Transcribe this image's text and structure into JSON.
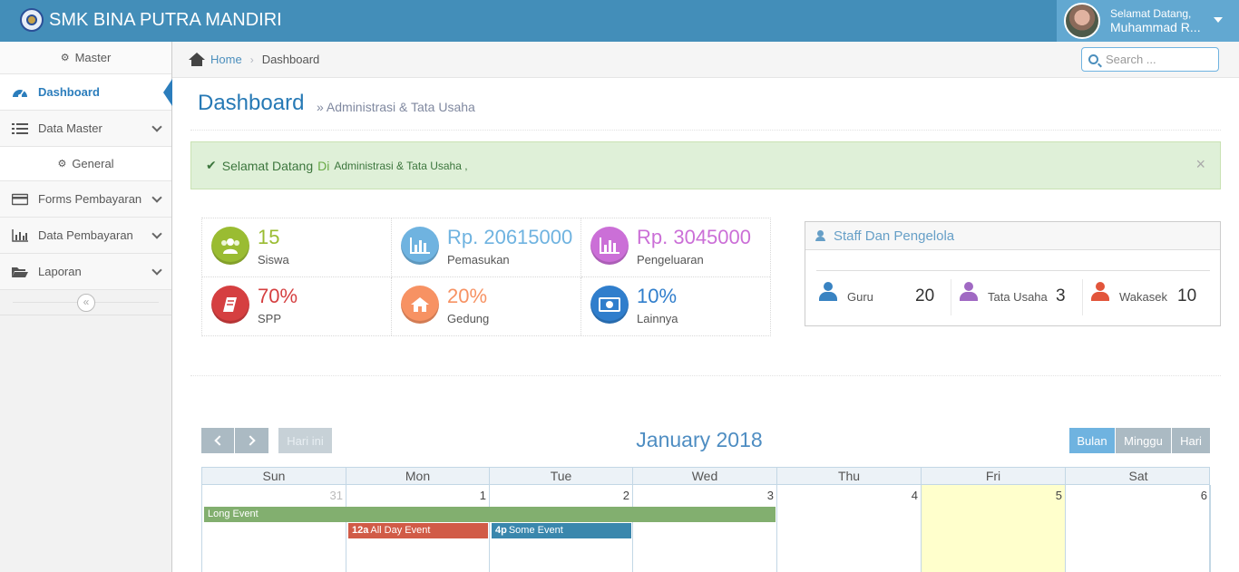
{
  "navbar": {
    "brand": "SMK BINA PUTRA MANDIRI",
    "greeting": "Selamat Datang,",
    "user_name": "Muhammad R..."
  },
  "sidebar": {
    "shortcut": "Master",
    "items": [
      {
        "label": "Dashboard",
        "icon": "tachometer-icon",
        "active": true
      },
      {
        "label": "Data Master",
        "icon": "list-icon"
      },
      {
        "label": "General",
        "icon": "gears-icon",
        "sub": true
      },
      {
        "label": "Forms Pembayaran",
        "icon": "credit-card-icon"
      },
      {
        "label": "Data Pembayaran",
        "icon": "bar-chart-icon"
      },
      {
        "label": "Laporan",
        "icon": "folder-open-icon"
      }
    ],
    "collapse_symbol": "«"
  },
  "breadcrumbs": {
    "home": "Home",
    "separator": "›",
    "current": "Dashboard"
  },
  "search": {
    "placeholder": "Search ..."
  },
  "page_header": {
    "title": "Dashboard",
    "subtitle": "» Administrasi & Tata Usaha"
  },
  "alert": {
    "text1": "Selamat Datang",
    "text2": "Di",
    "text3": "Administrasi & Tata Usaha ,",
    "close": "×"
  },
  "infoboxes": [
    {
      "value": "15",
      "label": "Siswa",
      "color": "#9abc32",
      "icon": "users-icon"
    },
    {
      "value": "Rp. 20615000",
      "label": "Pemasukan",
      "color": "#6fb3e0",
      "icon": "bar-chart-icon"
    },
    {
      "value": "Rp. 3045000",
      "label": "Pengeluaran",
      "color": "#cb6fd7",
      "icon": "bar-chart-icon"
    },
    {
      "value": "70%",
      "label": "SPP",
      "color": "#d53f40",
      "icon": "book-icon"
    },
    {
      "value": "20%",
      "label": "Gedung",
      "color": "#f79263",
      "icon": "home-icon"
    },
    {
      "value": "10%",
      "label": "Lainnya",
      "color": "#307ecc",
      "icon": "money-icon"
    }
  ],
  "staff_widget": {
    "title": "Staff Dan Pengelola",
    "items": [
      {
        "label": "Guru",
        "count": "20",
        "color": "#3983c2"
      },
      {
        "label": "Tata Usaha",
        "count": "3",
        "color": "#a069c3"
      },
      {
        "label": "Wakasek",
        "count": "10",
        "color": "#e2553b"
      }
    ]
  },
  "calendar": {
    "prev_symbol": "‹",
    "next_symbol": "›",
    "today_label": "Hari ini",
    "title": "January 2018",
    "views": [
      "Bulan",
      "Minggu",
      "Hari"
    ],
    "active_view": "Bulan",
    "weekdays": [
      "Sun",
      "Mon",
      "Tue",
      "Wed",
      "Thu",
      "Fri",
      "Sat"
    ],
    "days": [
      "31",
      "1",
      "2",
      "3",
      "4",
      "5",
      "6"
    ],
    "events": [
      {
        "time": "",
        "title": "Long Event",
        "color": "#82af6f"
      },
      {
        "time": "12a",
        "title": "All Day Event",
        "color": "#d15b47"
      },
      {
        "time": "4p",
        "title": "Some Event",
        "color": "#3a87ad"
      }
    ]
  }
}
